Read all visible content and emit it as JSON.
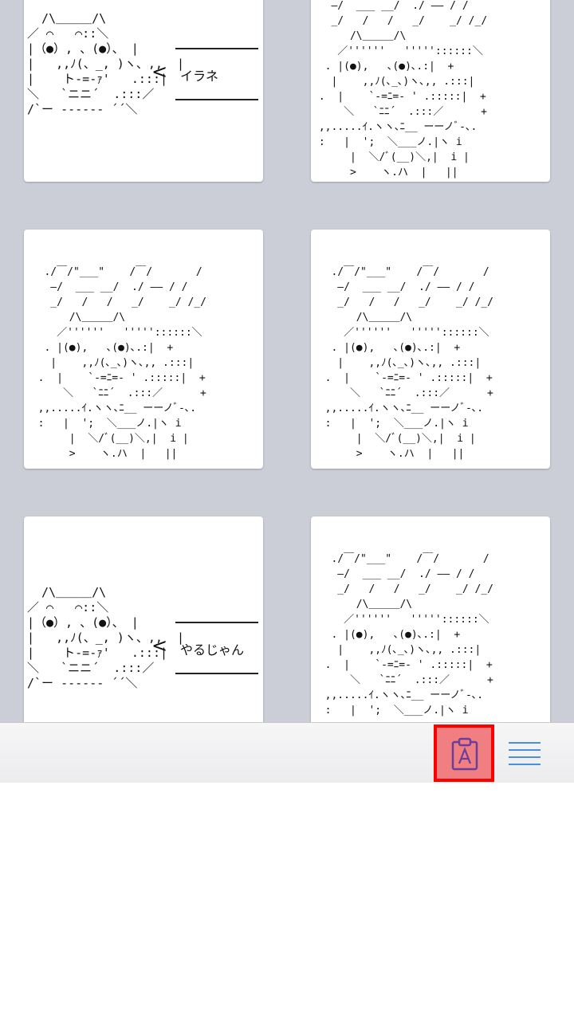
{
  "grid": {
    "cards": [
      {
        "type": "cat",
        "art": "  /\\＿＿＿/\\\n／ ⌒   ⌒::＼\n|（●）, 、(●）、 |\n|   ,,ﾉ(、_, )ヽ、,,  |\n|    ト‐=‐ｧ'   .:::|\n＼   `ニニ´  .:::／\n/`ー ‐‐‐‐‐‐ ´´＼",
        "bubble": "イラネ"
      },
      {
        "type": "dog",
        "art": "   ―/  ___ __/  ./ ―― / /\n   _/   /   /   _/    _/ /_/\n      /\\＿＿＿/\\\n    ／''''''   '''''::::::＼\n  . |(●),   ､(●)､.:|  +\n   |    ,,ﾉ(､_､)ヽ､,, .:::|\n .  |    `-=ﾆ=- ' .:::::|  +\n     ＼   `ﾆﾆ´  .:::／      +\n ,,.....ｲ.ヽヽ､ﾆ__ ーーノﾞ-､.\n :   |  ';  ＼___ノ.|ヽ i\n      |  ＼/ﾞ(__)＼,|  i |\n      >    ヽ.ハ  |   ||"
      },
      {
        "type": "dog",
        "art": "   ./￣/\"___\"    /￣/       /\n    ―/  ___ __/  ./ ―― / /\n    _/   /   /   _/    _/ /_/\n       /\\＿＿＿/\\\n     ／''''''   '''''::::::＼\n   . |(●),   ､(●)､.:|  +\n    |    ,,ﾉ(､_､)ヽ､,, .:::|\n  .  |    `-=ﾆ=- ' .:::::|  +\n      ＼   `ﾆﾆ´  .:::／      +\n  ,,.....ｲ.ヽヽ､ﾆ__ ーーノﾞ-､.\n  :   |  ';  ＼___ノ.|ヽ i\n       |  ＼/ﾞ(__)＼,|  i |\n       >    ヽ.ハ  |   ||"
      },
      {
        "type": "dog",
        "art": "   ./￣/\"___\"    /￣/       /\n    ―/  ___ __/  ./ ―― / /\n    _/   /   /   _/    _/ /_/\n       /\\＿＿＿/\\\n     ／''''''   '''''::::::＼\n   . |(●),   ､(●)､.:|  +\n    |    ,,ﾉ(､_､)ヽ､,, .:::|\n  .  |    `-=ﾆ=- ' .:::::|  +\n      ＼   `ﾆﾆ´  .:::／      +\n  ,,.....ｲ.ヽヽ､ﾆ__ ーーノﾞ-､.\n  :   |  ';  ＼___ノ.|ヽ i\n       |  ＼/ﾞ(__)＼,|  i |\n       >    ヽ.ハ  |   ||"
      },
      {
        "type": "cat",
        "art": "  /\\＿＿＿/\\\n／ ⌒   ⌒::＼\n|（●）, 、(●）、 |\n|   ,,ﾉ(、_, )ヽ、,,  |\n|    ト‐=‐ｧ'   .:::|\n＼   `ニニ´  .:::／\n/`ー ‐‐‐‐‐‐ ´´＼",
        "bubble": "やるじゃん"
      },
      {
        "type": "dog",
        "art": "   ./￣/\"___\"    /￣/       /\n    ―/  ___ __/  ./ ―― / /\n    _/   /   /   _/    _/ /_/\n       /\\＿＿＿/\\\n     ／''''''   '''''::::::＼\n   . |(●),   ､(●)､.:|  +\n    |    ,,ﾉ(､_､)ヽ､,, .:::|\n  .  |    `-=ﾆ=- ' .:::::|  +\n      ＼   `ﾆﾆ´  .:::／      +\n  ,,.....ｲ.ヽヽ､ﾆ__ ーーノﾞ-､.\n  :   |  ';  ＼___ノ.|ヽ i"
      }
    ]
  },
  "toolbar": {
    "paste_icon": "clipboard-a-icon",
    "menu_icon": "hamburger-menu-icon",
    "paste_bg": "#f17f82",
    "highlight": "#ff0000",
    "menu_color": "#4a90e2"
  }
}
